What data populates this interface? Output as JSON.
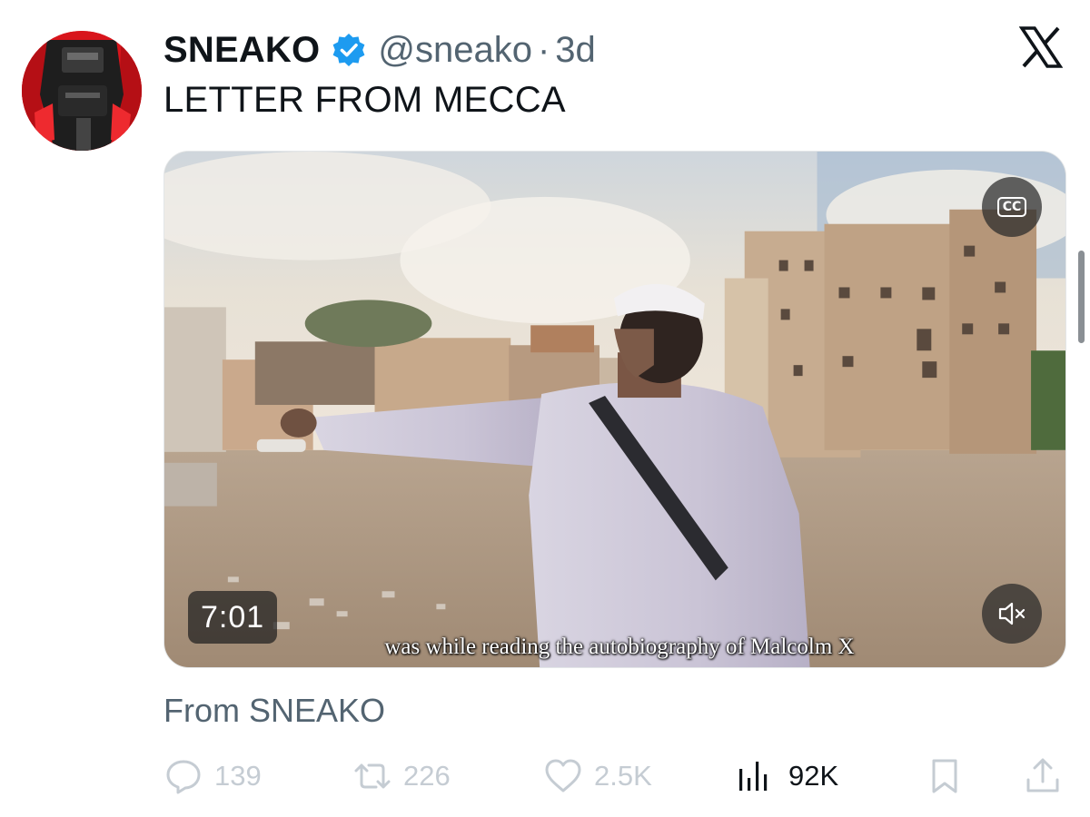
{
  "author": {
    "display_name": "SNEAKO",
    "handle": "@sneako",
    "separator": "·",
    "time": "3d",
    "verified": true
  },
  "tweet": {
    "text": "LETTER FROM MECCA"
  },
  "media": {
    "duration": "7:01",
    "subtitle": "was while reading the autobiography of Malcolm X",
    "cc_label": "CC",
    "muted": true
  },
  "source_text": "From SNEAKO",
  "actions": {
    "replies": "139",
    "reposts": "226",
    "likes": "2.5K",
    "views": "92K"
  },
  "colors": {
    "verified": "#1d9bf0",
    "muted_text": "#536471",
    "action_icon": "#c5ccd3"
  },
  "icons": {
    "logo": "x-logo-icon",
    "verified": "verified-badge-icon",
    "reply": "reply-icon",
    "repost": "repost-icon",
    "like": "heart-icon",
    "views": "views-chart-icon",
    "bookmark": "bookmark-icon",
    "share": "share-icon",
    "cc": "closed-captions-icon",
    "mute": "speaker-muted-icon"
  }
}
